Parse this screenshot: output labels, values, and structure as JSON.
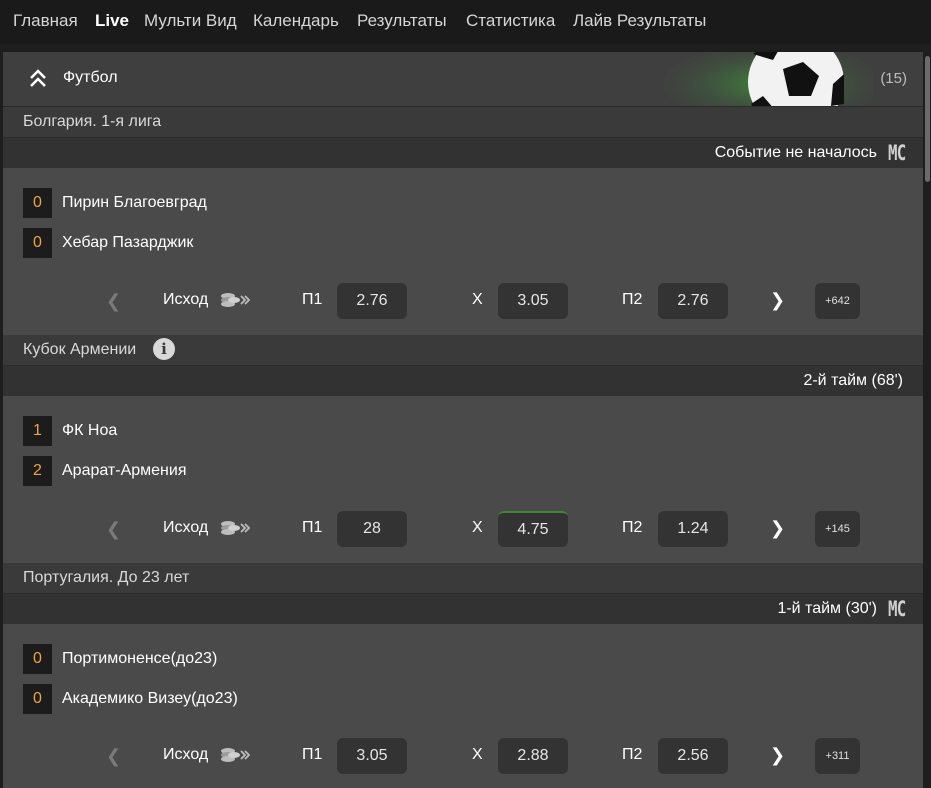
{
  "nav": [
    "Главная",
    "Live",
    "Мульти Вид",
    "Календарь",
    "Результаты",
    "Статистика",
    "Лайв Результаты"
  ],
  "sport": {
    "title": "Футбол",
    "count": "(15)"
  },
  "matches": [
    {
      "league": "Болгария. 1-я лига",
      "status": "Событие не началось",
      "team1": {
        "score": "0",
        "name": "Пирин Благоевград"
      },
      "team2": {
        "score": "0",
        "name": "Хебар Пазарджик"
      },
      "outcome": "Исход",
      "p1_label": "П1",
      "p1": "2.76",
      "x_label": "Х",
      "x": "3.05",
      "p2_label": "П2",
      "p2": "2.76",
      "more": "+642",
      "mc": "MC"
    },
    {
      "league": "Кубок Армении",
      "status": "2-й тайм  (68')",
      "team1": {
        "score": "1",
        "name": "ФК Ноа"
      },
      "team2": {
        "score": "2",
        "name": "Арарат-Армения"
      },
      "outcome": "Исход",
      "p1_label": "П1",
      "p1": "28",
      "x_label": "Х",
      "x": "4.75",
      "p2_label": "П2",
      "p2": "1.24",
      "more": "+145",
      "info": "i"
    },
    {
      "league": "Португалия. До 23 лет",
      "status": "1-й тайм  (30')",
      "team1": {
        "score": "0",
        "name": "Портимоненсе(до23)"
      },
      "team2": {
        "score": "0",
        "name": "Академико Визеу(до23)"
      },
      "outcome": "Исход",
      "p1_label": "П1",
      "p1": "3.05",
      "x_label": "Х",
      "x": "2.88",
      "p2_label": "П2",
      "p2": "2.56",
      "more": "+311",
      "mc": "MC"
    }
  ],
  "colors": {
    "score": "#f0a535",
    "highlight": "#3c8a2e"
  }
}
